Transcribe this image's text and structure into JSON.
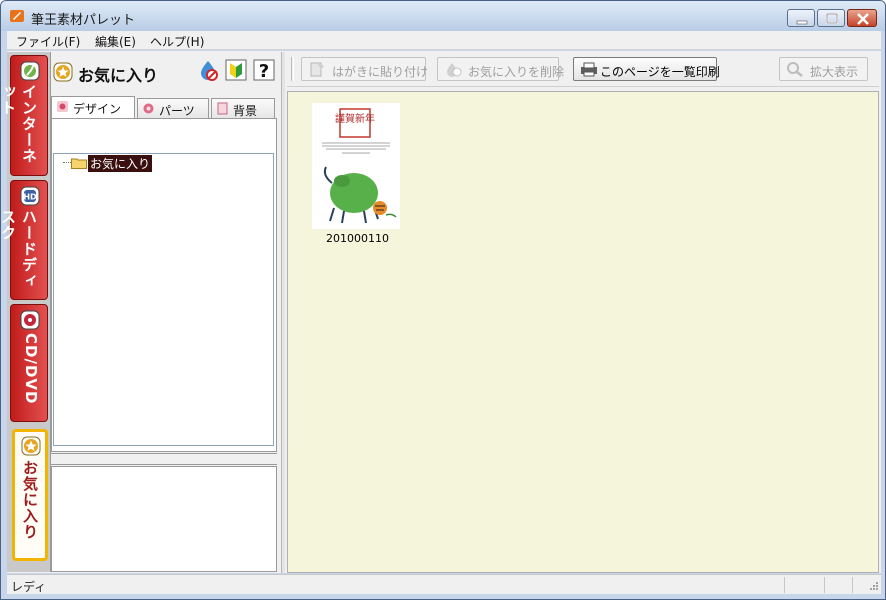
{
  "window": {
    "title": "筆王素材パレット",
    "icons": [
      "app-icon",
      "minimize-icon",
      "maximize-icon",
      "close-icon"
    ]
  },
  "menu": {
    "items": [
      {
        "label": "ファイル(F)"
      },
      {
        "label": "編集(E)"
      },
      {
        "label": "ヘルプ(H)"
      }
    ]
  },
  "side_tabs": [
    {
      "label": "インターネット",
      "icon": "globe-icon"
    },
    {
      "label": "ハードディスク",
      "icon": "hard-disk-icon"
    },
    {
      "label": "CD/DVD",
      "icon": "disc-icon"
    },
    {
      "label": "お気に入り",
      "icon": "star-icon",
      "selected": true
    }
  ],
  "left_panel": {
    "title": "お気に入り",
    "tool_icons": [
      "remove-favorite-icon",
      "beginner-mark-icon",
      "help-icon"
    ],
    "tabs": [
      {
        "label": "デザイン",
        "active": true
      },
      {
        "label": "パーツ"
      },
      {
        "label": "背景"
      }
    ],
    "tree": {
      "root_label": "お気に入り"
    }
  },
  "toolbar": {
    "buttons": [
      {
        "label": "はがきに貼り付け",
        "enabled": false
      },
      {
        "label": "お気に入りを削除",
        "enabled": false
      },
      {
        "label": "このページを一覧印刷",
        "enabled": true
      },
      {
        "label": "拡大表示",
        "enabled": false
      }
    ]
  },
  "content": {
    "items": [
      {
        "filename": "201000110",
        "text": "謹賀新年"
      }
    ]
  },
  "status": {
    "text": "レディ"
  },
  "colors": {
    "content_bg": "#f5f5dc",
    "side_tab_red": "#c21b1b",
    "selected_tab_border": "#f3b400"
  }
}
